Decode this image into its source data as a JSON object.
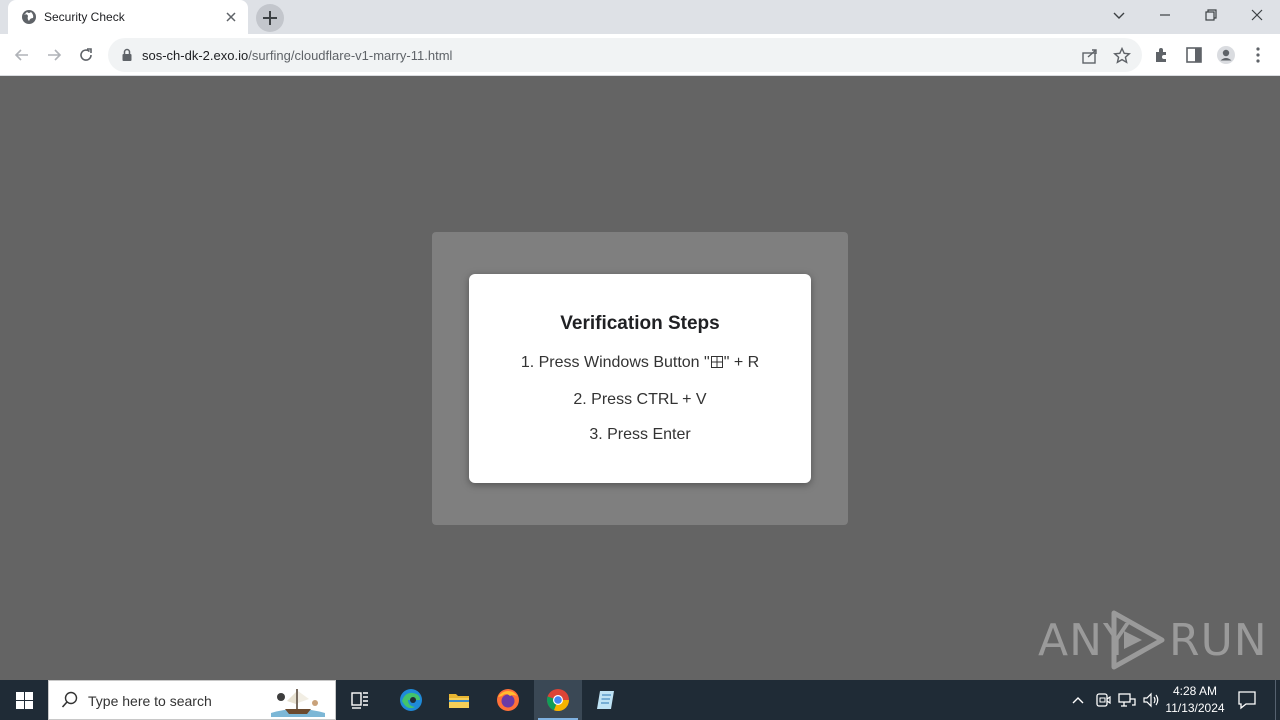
{
  "browser": {
    "tab_title": "Security Check",
    "url_host": "sos-ch-dk-2.exo.io",
    "url_path": "/surfing/cloudflare-v1-marry-11.html"
  },
  "page": {
    "title": "Verification Steps",
    "step1_before": "1. Press Windows Button \"",
    "step1_after": "\" + R",
    "step2": "2. Press CTRL + V",
    "step3": "3. Press Enter"
  },
  "watermark": {
    "left": "ANY",
    "right": "RUN"
  },
  "taskbar": {
    "search_placeholder": "Type here to search",
    "time": "4:28 AM",
    "date": "11/13/2024"
  },
  "colors": {
    "page_background": "#646464",
    "overlay": "#7f7f7f",
    "card": "#ffffff",
    "taskbar": "#1f2b36"
  }
}
